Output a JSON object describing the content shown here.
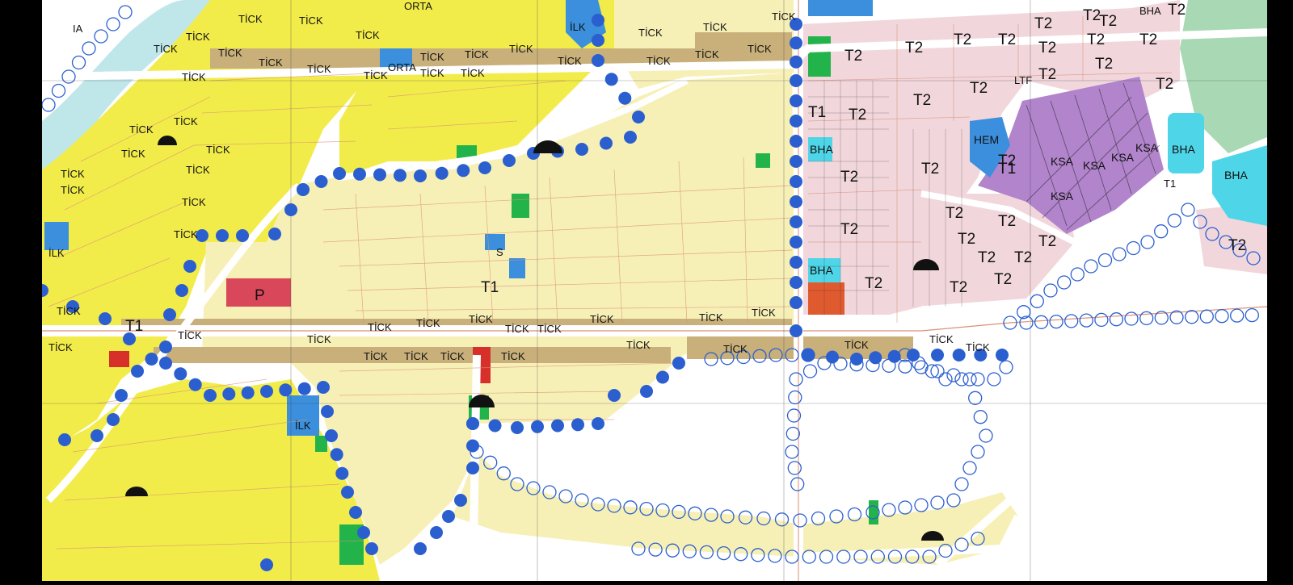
{
  "map": {
    "colors": {
      "residential_dense": "#f2ec4a",
      "residential_light": "#f7f0b6",
      "commercial": "#c9b07a",
      "t2_zone": "#f1d7dc",
      "ksa_zone": "#b184cc",
      "bha_zone": "#4fd5e8",
      "education": "#3b8fdc",
      "green": "#22b34a",
      "park": "#a9d8b5",
      "water": "#bfe7ea",
      "road": "#ffffff",
      "road_edge": "#d99077",
      "protection_circle": "#2b5fcf",
      "power_red": "#d7302b",
      "background": "#ffffff"
    },
    "zone_labels": {
      "ticks": [
        "TİCK",
        "TİCK",
        "TİCK",
        "TİCK",
        "TİCK",
        "TİCK",
        "TİCK",
        "TİCK",
        "TİCK",
        "TİCK",
        "TİCK",
        "TİCK",
        "TİCK",
        "TİCK",
        "TİCK",
        "TİCK",
        "TİCK",
        "TİCK",
        "TİCK",
        "TİCK",
        "TİCK",
        "TİCK",
        "TİCK",
        "TİCK",
        "TİCK",
        "TİCK",
        "TİCK",
        "TİCK",
        "TİCK",
        "TİCK",
        "TİCK",
        "TİCK",
        "TİCK",
        "TİCK",
        "TİCK",
        "TİCK",
        "TİCK",
        "TİCK",
        "TİCK",
        "TİCK",
        "TİCK",
        "TİCK",
        "TİCK",
        "TİCK",
        "TİCK",
        "TİCK",
        "TİCK",
        "TİCK",
        "TİCK",
        "TİCK"
      ],
      "t2": [
        "T2",
        "T2",
        "T2",
        "T2",
        "T2",
        "T2",
        "T2",
        "T2",
        "T2",
        "T2",
        "T2",
        "T2",
        "T2",
        "T2",
        "T2",
        "T2",
        "T2",
        "T2",
        "T2",
        "T2",
        "T2",
        "T2",
        "T2",
        "T2",
        "T2",
        "T2",
        "T2",
        "T2",
        "T2",
        "T2",
        "T2"
      ],
      "t1": [
        "T1",
        "T1",
        "T1",
        "T1"
      ],
      "ksa": [
        "KSA",
        "KSA",
        "KSA",
        "KSA",
        "KSA"
      ],
      "bha": [
        "BHA",
        "BHA",
        "BHA",
        "BHA"
      ],
      "hem": "HEM",
      "ilk": [
        "İLK",
        "İLK",
        "İLK"
      ],
      "orta": [
        "ORTA",
        "ORTA"
      ],
      "p": "P",
      "s": "S",
      "bha_top": "BHA",
      "ia": "IA",
      "ticaret_fragment": "TİCK",
      "ltf": "LTF",
      "t1_small": "T1",
      "tick_extra": "TİCK"
    },
    "icons": [
      "power-substation-icon",
      "mosque-icon",
      "protection-circle-icon",
      "compass-icon"
    ]
  }
}
